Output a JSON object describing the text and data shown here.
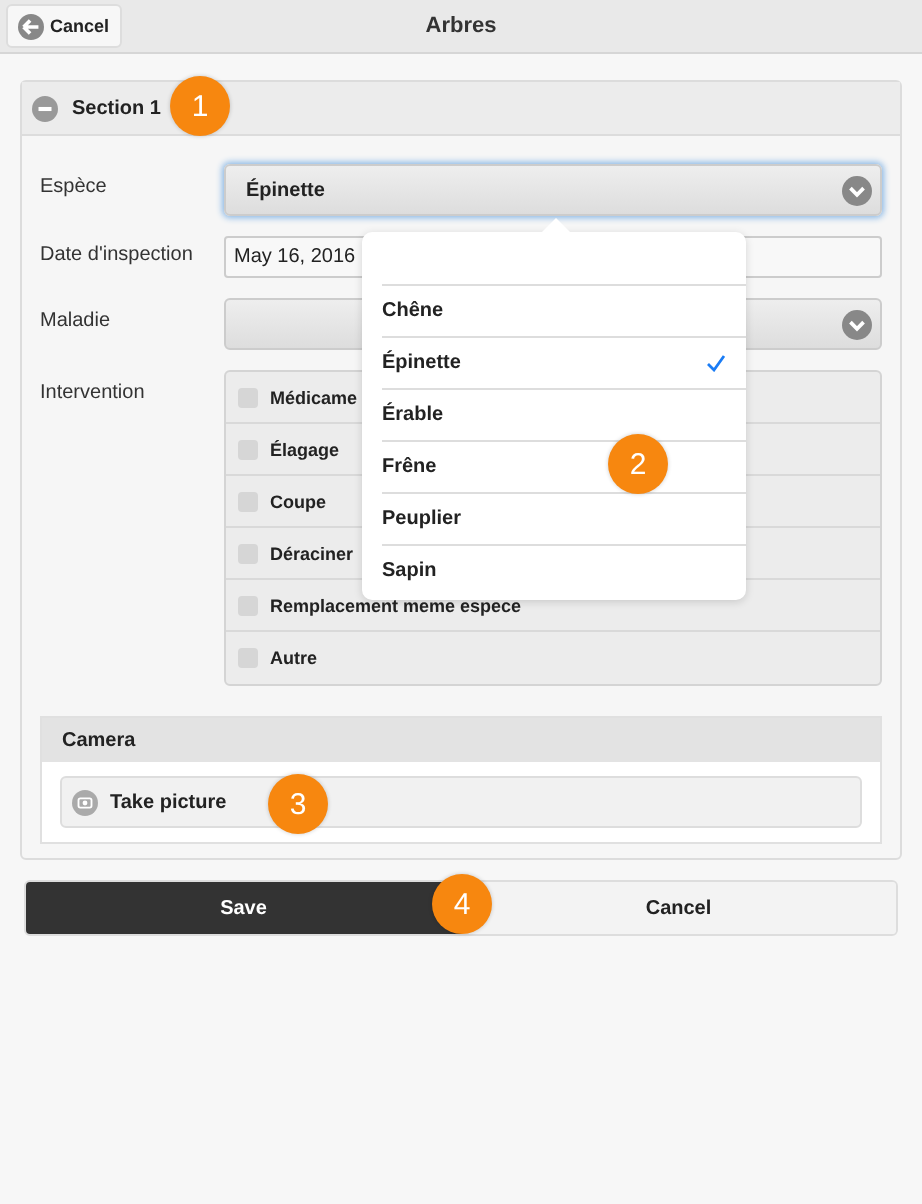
{
  "header": {
    "back_button": "Cancel",
    "title": "Arbres"
  },
  "section": {
    "title": "Section 1",
    "expanded": true,
    "fields": [
      {
        "kind": "select",
        "label": "Espèce",
        "value": "Épinette",
        "focused": true
      },
      {
        "kind": "date",
        "label": "Date d'inspection",
        "value": "May 16, 2016"
      },
      {
        "kind": "select",
        "label": "Maladie",
        "focused": false
      },
      {
        "kind": "checklist",
        "label": "Intervention",
        "options": [
          {
            "label": "Médicame",
            "checked": false
          },
          {
            "label": "Élagage",
            "checked": false
          },
          {
            "label": "Coupe",
            "checked": false
          },
          {
            "label": "Déraciner",
            "checked": false
          },
          {
            "label": "Remplacement meme espece",
            "checked": false
          },
          {
            "label": "Autre",
            "checked": false
          }
        ]
      }
    ],
    "camera": {
      "title": "Camera",
      "button": "Take picture"
    }
  },
  "dropdown": {
    "options": [
      {
        "label": "Chêne",
        "selected": false
      },
      {
        "label": "Épinette",
        "selected": true
      },
      {
        "label": "Érable",
        "selected": false
      },
      {
        "label": "Frêne",
        "selected": false
      },
      {
        "label": "Peuplier",
        "selected": false
      },
      {
        "label": "Sapin",
        "selected": false
      }
    ]
  },
  "actions": [
    {
      "label": "Save",
      "kind": "primary"
    },
    {
      "label": "Cancel",
      "kind": "secondary"
    }
  ],
  "callouts": [
    "1",
    "2",
    "3",
    "4"
  ]
}
